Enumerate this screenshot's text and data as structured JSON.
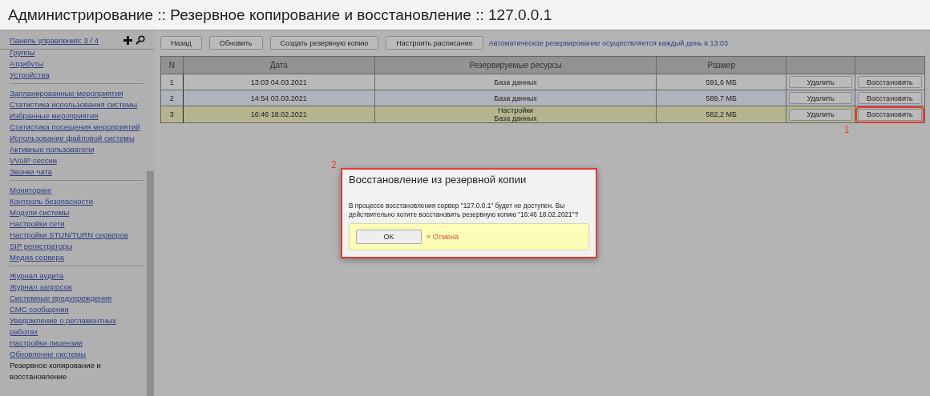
{
  "title": "Администрирование :: Резервное копирование и восстановление :: 127.0.0.1",
  "sidebar": {
    "header": "Панель управления: 3 / 4",
    "groups": [
      {
        "items": [
          {
            "label": "Группы",
            "selected": false
          },
          {
            "label": "Атрибуты",
            "selected": false
          },
          {
            "label": "Устройства",
            "selected": false
          }
        ]
      },
      {
        "items": [
          {
            "label": "Запланированные мероприятия",
            "selected": false
          },
          {
            "label": "Статистика использования системы",
            "selected": false
          },
          {
            "label": "Избранные мероприятия",
            "selected": false
          },
          {
            "label": "Статистика посещения мероприятий",
            "selected": false
          },
          {
            "label": "Использование файловой системы",
            "selected": false
          },
          {
            "label": "Активные пользователи",
            "selected": false
          },
          {
            "label": "VVoIP сессии",
            "selected": false
          },
          {
            "label": "Звонки чата",
            "selected": false
          }
        ]
      },
      {
        "items": [
          {
            "label": "Мониторинг",
            "selected": false
          },
          {
            "label": "Контроль безопасности",
            "selected": false
          },
          {
            "label": "Модули системы",
            "selected": false
          },
          {
            "label": "Настройки сети",
            "selected": false
          },
          {
            "label": "Настройки STUN/TURN серверов",
            "selected": false
          },
          {
            "label": "SIP регистраторы",
            "selected": false
          },
          {
            "label": "Медиа сервера",
            "selected": false
          }
        ]
      },
      {
        "items": [
          {
            "label": "Журнал аудита",
            "selected": false
          },
          {
            "label": "Журнал запросов",
            "selected": false
          },
          {
            "label": "Системные предупреждения",
            "selected": false
          },
          {
            "label": "СМС сообщения",
            "selected": false
          },
          {
            "label": "Уведомление о регламентных работах",
            "selected": false
          },
          {
            "label": "Настройки лицензии",
            "selected": false
          },
          {
            "label": "Обновление системы",
            "selected": false
          },
          {
            "label": "Резервное копирование и восстановление",
            "selected": true
          }
        ]
      }
    ]
  },
  "toolbar": {
    "buttons": [
      "Назад",
      "Обновить",
      "Создать резервную копию",
      "Настроить расписание"
    ],
    "note": "Автоматическое резервирование осуществляется каждый день в 13:03"
  },
  "table": {
    "columns": [
      "N",
      "Дата",
      "Резервируемые ресурсы",
      "Размер"
    ],
    "rows": [
      {
        "n": "1",
        "date": "13:03 04.03.2021",
        "resources": [
          "База данных"
        ],
        "size": "591,6 МБ",
        "delete": "Удалить",
        "restore": "Восстановить",
        "selected": false,
        "restore_highlighted": false
      },
      {
        "n": "2",
        "date": "14:54 03.03.2021",
        "resources": [
          "База данных"
        ],
        "size": "589,7 МБ",
        "delete": "Удалить",
        "restore": "Восстановить",
        "selected": false,
        "restore_highlighted": false
      },
      {
        "n": "3",
        "date": "16:46 18.02.2021",
        "resources": [
          "Настройки",
          "База данных"
        ],
        "size": "582,2 МБ",
        "delete": "Удалить",
        "restore": "Восстановить",
        "selected": true,
        "restore_highlighted": true,
        "callout": "1"
      }
    ]
  },
  "dialog": {
    "callout": "2",
    "title": "Восстановление из резервной копии",
    "message": "В процессе восстановления сервер \"127.0.0.1\" будет не доступен. Вы действительно хотите восстановить резервную копию \"16:46 18.02.2021\"?",
    "ok": "OK",
    "cancel_icon": "×",
    "cancel": "Отмена"
  }
}
